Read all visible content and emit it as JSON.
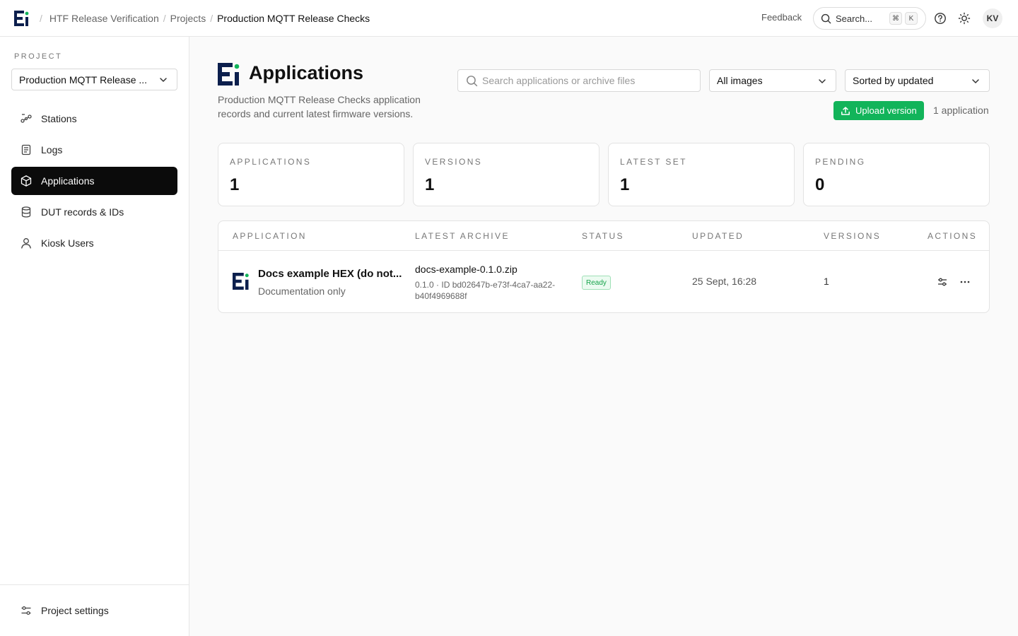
{
  "topbar": {
    "breadcrumbs": [
      "HTF Release Verification",
      "Projects",
      "Production MQTT Release Checks"
    ],
    "feedback_label": "Feedback",
    "search_label": "Search...",
    "shortcut_keys": [
      "⌘",
      "K"
    ],
    "avatar_initials": "KV"
  },
  "sidebar": {
    "project_label": "PROJECT",
    "project_selected": "Production MQTT Release ...",
    "items": [
      {
        "label": "Stations",
        "icon": "stations-icon"
      },
      {
        "label": "Logs",
        "icon": "logs-icon"
      },
      {
        "label": "Applications",
        "icon": "package-icon",
        "active": true
      },
      {
        "label": "DUT records & IDs",
        "icon": "database-icon"
      },
      {
        "label": "Kiosk Users",
        "icon": "user-icon"
      }
    ],
    "settings_label": "Project settings"
  },
  "main": {
    "title": "Applications",
    "description": "Production MQTT Release Checks application records and current latest firmware versions.",
    "search_placeholder": "Search applications or archive files",
    "filter_selected": "All images",
    "sort_selected": "Sorted by updated",
    "upload_label": "Upload version",
    "app_count": "1 application",
    "stats": [
      {
        "label": "APPLICATIONS",
        "value": "1"
      },
      {
        "label": "VERSIONS",
        "value": "1"
      },
      {
        "label": "LATEST SET",
        "value": "1"
      },
      {
        "label": "PENDING",
        "value": "0"
      }
    ],
    "table": {
      "columns": [
        "APPLICATION",
        "LATEST ARCHIVE",
        "STATUS",
        "UPDATED",
        "VERSIONS",
        "ACTIONS"
      ],
      "rows": [
        {
          "name": "Docs example HEX (do not...",
          "subtitle": "Documentation only",
          "archive": "docs-example-0.1.0.zip",
          "archive_meta": "0.1.0 · ID bd02647b-e73f-4ca7-aa22-b40f4969688f",
          "status": "Ready",
          "updated": "25 Sept, 16:28",
          "versions": "1"
        }
      ]
    }
  },
  "colors": {
    "accent_green": "#12b45a",
    "brand_navy": "#0c1f4d",
    "active_nav": "#0b0b0b"
  }
}
